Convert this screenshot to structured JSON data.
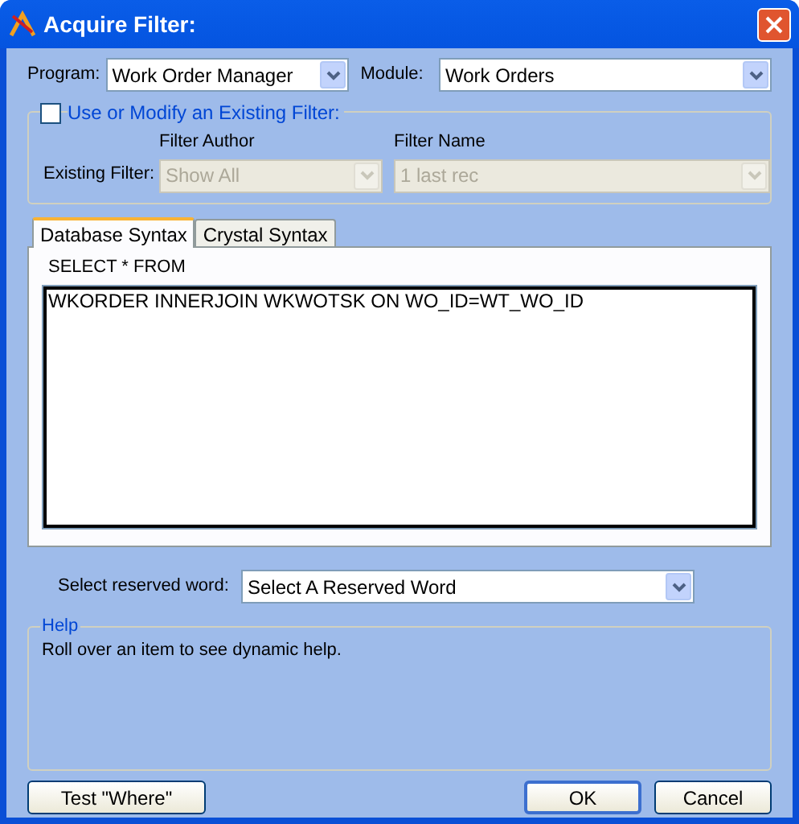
{
  "window": {
    "title": "Acquire Filter:"
  },
  "program": {
    "label": "Program:",
    "value": "Work Order Manager"
  },
  "module": {
    "label": "Module:",
    "value": "Work Orders"
  },
  "existing_filter": {
    "label": "Use or Modify an Existing Filter:",
    "checked": false,
    "row_label": "Existing Filter:",
    "author": {
      "label": "Filter Author",
      "value": "Show All",
      "disabled": true
    },
    "name": {
      "label": "Filter Name",
      "value": "1 last rec",
      "disabled": true
    }
  },
  "tabs": [
    {
      "label": "Database Syntax",
      "selected": true
    },
    {
      "label": "Crystal Syntax",
      "selected": false
    }
  ],
  "syntax": {
    "prefix": "SELECT * FROM",
    "value": "WKORDER INNERJOIN WKWOTSK ON WO_ID=WT_WO_ID"
  },
  "reserved_word": {
    "label": "Select reserved word:",
    "value": "Select A Reserved Word"
  },
  "help": {
    "title": "Help",
    "text": "Roll over an item to see dynamic help."
  },
  "buttons": {
    "test": "Test \"Where\"",
    "ok": "OK",
    "cancel": "Cancel"
  }
}
